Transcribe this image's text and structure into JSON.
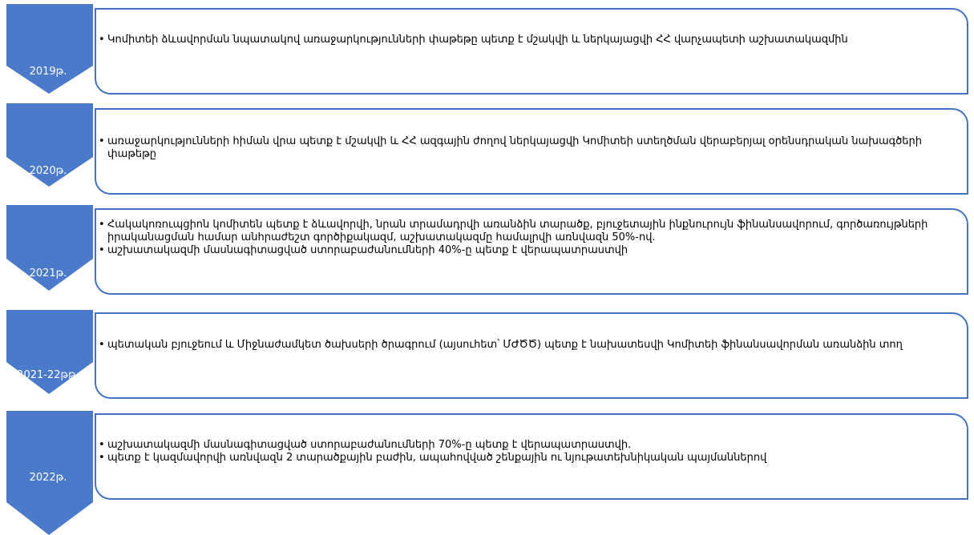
{
  "colors": {
    "chevron": "#4a7ac9",
    "box_border": "#4472c4",
    "label_text": "#ffffff",
    "body_text": "#000000"
  },
  "stages": [
    {
      "label": "2019թ.",
      "bullets": [
        "Կոմիտեի ձևավորման նպատակով առաջարկությունների փաթեթը պետք է մշակվի և ներկայացվի ՀՀ վարչապետի աշխատակազմին"
      ]
    },
    {
      "label": "2020թ.",
      "bullets": [
        "առաջարկությունների հիման վրա պետք է մշակվի և ՀՀ ազգային ժողով ներկայացվի Կոմիտեի ստեղծման վերաբերյալ օրենսդրական նախագծերի փաթեթը"
      ]
    },
    {
      "label": "2021թ.",
      "bullets": [
        "Հակակոռուպցիոն կոմիտեն պետք է ձևավորվի, նրան տրամադրվի առանձին տարածք, բյուջետային ինքնուրույն ֆինանսավորում, գործառույթների իրականացման համար անհրաժեշտ գործիքակազմ, աշխատակազմը համալրվի առնվազն 50%-ով.",
        "աշխատակազմի մասնագիտացված ստորաբաժանումների 40%-ը պետք է վերապատրաստվի"
      ]
    },
    {
      "label": "2021-22թթ.",
      "bullets": [
        "պետական բյուջեում և Միջնաժամկետ ծախսերի ծրագրում (այսուհետ՝ ՄԺԾԾ) պետք է նախատեսվի Կոմիտեի ֆինանսավորման առանձին տող"
      ]
    },
    {
      "label": "2022թ.",
      "bullets": [
        "աշխատակազմի մասնագիտացված ստորաբաժանումների 70%-ը պետք է վերապատրաստվի.",
        "պետք է կազմավորվի առնվազն 2 տարածքային բաժին, ապահովված շենքային ու նյութատեխնիկական պայմաններով"
      ]
    }
  ]
}
